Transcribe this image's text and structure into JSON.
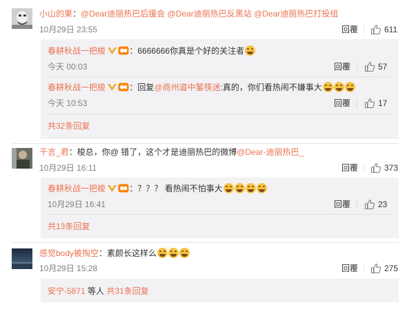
{
  "comments": [
    {
      "author": "小山的果",
      "text": "@Dear迪丽热巴后援会 @Dear迪丽热巴反黑站 @Dear迪丽热巴打投组",
      "time": "10月29日 23:55",
      "reply_label": "回覆",
      "likes": "611",
      "replies": [
        {
          "author": "春耕秋战一把梭",
          "text": "6666666你真是个好的关注者",
          "time": "今天 00:03",
          "reply_label": "回覆",
          "likes": "57"
        },
        {
          "author": "春耕秋战一把梭",
          "prefix": "回复",
          "mention": "@商州道中錾筷迷",
          "text": "真的，你们看热闹不嫌事大",
          "time": "今天 10:53",
          "reply_label": "回覆",
          "likes": "17"
        }
      ],
      "more_replies": "共32条回复"
    },
    {
      "author": "千言_君",
      "text": "梭总，你@ 错了，这个才是迪丽热巴的微博",
      "mention": "@Dear-迪丽热巴_",
      "time": "10月29日 16:11",
      "reply_label": "回覆",
      "likes": "373",
      "replies": [
        {
          "author": "春耕秋战一把梭",
          "text": "？？？ 看热闹不怕事大",
          "time": "10月29日 16:41",
          "reply_label": "回覆",
          "likes": "23"
        }
      ],
      "more_replies": "共13条回复"
    },
    {
      "author": "感觉body被掏空",
      "text": "素颜长这样么",
      "time": "10月29日 15:28",
      "reply_label": "回覆",
      "likes": "275",
      "footer_user": "安宁-5871",
      "footer_mid": "等人",
      "more_replies": "共31条回复"
    }
  ],
  "colors": {
    "link": "#eb7350",
    "reply_bg": "#f2f2f5",
    "blue": "#507daf"
  }
}
